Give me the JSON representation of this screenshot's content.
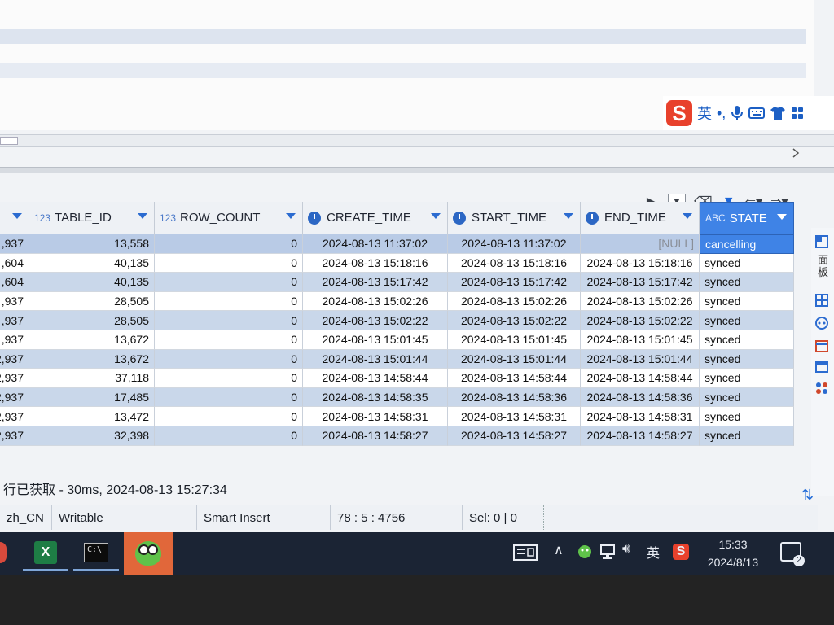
{
  "ime": {
    "lang": "英",
    "punct": "•,",
    "logo": "S"
  },
  "columns": [
    {
      "type": "",
      "name": ""
    },
    {
      "type": "123",
      "name": "TABLE_ID"
    },
    {
      "type": "123",
      "name": "ROW_COUNT"
    },
    {
      "type": "clock",
      "name": "CREATE_TIME"
    },
    {
      "type": "clock",
      "name": "START_TIME"
    },
    {
      "type": "clock",
      "name": "END_TIME"
    },
    {
      "type": "ABC",
      "name": "STATE"
    }
  ],
  "rows": [
    [
      ",937",
      "13,558",
      "0",
      "2024-08-13 11:37:02",
      "2024-08-13 11:37:02",
      "[NULL]",
      "cancelling"
    ],
    [
      ",604",
      "40,135",
      "0",
      "2024-08-13 15:18:16",
      "2024-08-13 15:18:16",
      "2024-08-13 15:18:16",
      "synced"
    ],
    [
      ",604",
      "40,135",
      "0",
      "2024-08-13 15:17:42",
      "2024-08-13 15:17:42",
      "2024-08-13 15:17:42",
      "synced"
    ],
    [
      ",937",
      "28,505",
      "0",
      "2024-08-13 15:02:26",
      "2024-08-13 15:02:26",
      "2024-08-13 15:02:26",
      "synced"
    ],
    [
      ",937",
      "28,505",
      "0",
      "2024-08-13 15:02:22",
      "2024-08-13 15:02:22",
      "2024-08-13 15:02:22",
      "synced"
    ],
    [
      ",937",
      "13,672",
      "0",
      "2024-08-13 15:01:45",
      "2024-08-13 15:01:45",
      "2024-08-13 15:01:45",
      "synced"
    ],
    [
      "2,937",
      "13,672",
      "0",
      "2024-08-13 15:01:44",
      "2024-08-13 15:01:44",
      "2024-08-13 15:01:44",
      "synced"
    ],
    [
      "2,937",
      "37,118",
      "0",
      "2024-08-13 14:58:44",
      "2024-08-13 14:58:44",
      "2024-08-13 14:58:44",
      "synced"
    ],
    [
      "2,937",
      "17,485",
      "0",
      "2024-08-13 14:58:35",
      "2024-08-13 14:58:36",
      "2024-08-13 14:58:36",
      "synced"
    ],
    [
      "2,937",
      "13,472",
      "0",
      "2024-08-13 14:58:31",
      "2024-08-13 14:58:31",
      "2024-08-13 14:58:31",
      "synced"
    ],
    [
      "2,937",
      "32,398",
      "0",
      "2024-08-13 14:58:27",
      "2024-08-13 14:58:27",
      "2024-08-13 14:58:27",
      "synced"
    ]
  ],
  "fetched_status": "行已获取 - 30ms, 2024-08-13 15:27:34",
  "statusbar": {
    "locale": "zh_CN",
    "mode": "Writable",
    "insert": "Smart Insert",
    "position": "78 : 5 : 4756",
    "selection": "Sel: 0 | 0"
  },
  "side_label": "面板",
  "taskbar": {
    "excel_label": "X",
    "terminal_label": "C:\\",
    "tray_lang": "英",
    "tray_sogou": "S",
    "time": "15:33",
    "date": "2024/8/13",
    "notifications": "2"
  }
}
